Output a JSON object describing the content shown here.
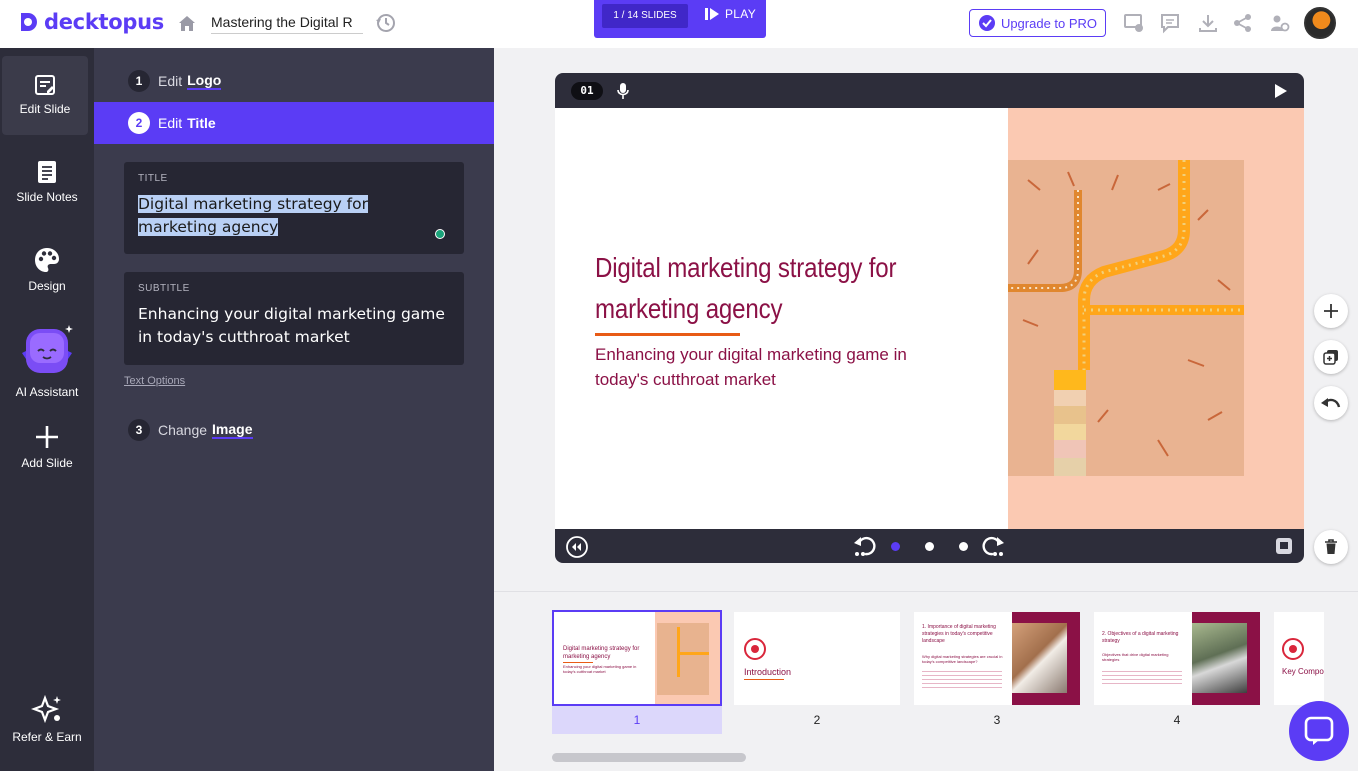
{
  "app": {
    "brand": "decktopus",
    "doc_title": "Mastering the Digital R"
  },
  "topbar": {
    "slides_count": "1 / 14 SLIDES",
    "play_label": "PLAY",
    "upgrade_label": "Upgrade to PRO",
    "icons": [
      "home-icon",
      "history-icon",
      "present-settings-icon",
      "comment-icon",
      "download-icon",
      "share-icon",
      "team-icon"
    ]
  },
  "leftnav": {
    "items": [
      {
        "label": "Edit Slide",
        "icon": "edit-slide-icon",
        "active": true
      },
      {
        "label": "Slide Notes",
        "icon": "notes-icon"
      },
      {
        "label": "Design",
        "icon": "palette-icon"
      },
      {
        "label": "AI Assistant",
        "icon": "ai-assistant-icon"
      },
      {
        "label": "Add Slide",
        "icon": "plus-icon"
      },
      {
        "label": "Refer & Earn",
        "icon": "sparkle-icon"
      }
    ]
  },
  "panel": {
    "steps": [
      {
        "num": "1",
        "verb": "Edit",
        "target": "Logo"
      },
      {
        "num": "2",
        "verb": "Edit",
        "target": "Title"
      },
      {
        "num": "3",
        "verb": "Change",
        "target": "Image"
      }
    ],
    "title_field": {
      "label": "TITLE",
      "value": "Digital marketing strategy for marketing agency"
    },
    "subtitle_field": {
      "label": "SUBTITLE",
      "value": "Enhancing your digital marketing game in today's cutthroat market"
    },
    "text_options": "Text Options"
  },
  "slide": {
    "number": "01",
    "title": "Digital marketing strategy for marketing agency",
    "subtitle": "Enhancing your digital marketing game in today's cutthroat market",
    "accent_color": "#8b1146",
    "underline_color": "#e85b16"
  },
  "thumbnails": [
    {
      "num": "1",
      "title": "Digital marketing strategy for marketing agency",
      "sub": "Enhancing your digital marketing game in today's cutthroat market"
    },
    {
      "num": "2",
      "title": "Introduction"
    },
    {
      "num": "3",
      "title": "1. Importance of digital marketing strategies in today's competitive landscape",
      "sub": "Why digital marketing strategies are crucial in today's competitive landscape?"
    },
    {
      "num": "4",
      "title": "2. Objectives of a digital marketing strategy",
      "sub": "Objectives that drive digital marketing strategies"
    },
    {
      "num": "",
      "title": "Key Compone"
    }
  ]
}
